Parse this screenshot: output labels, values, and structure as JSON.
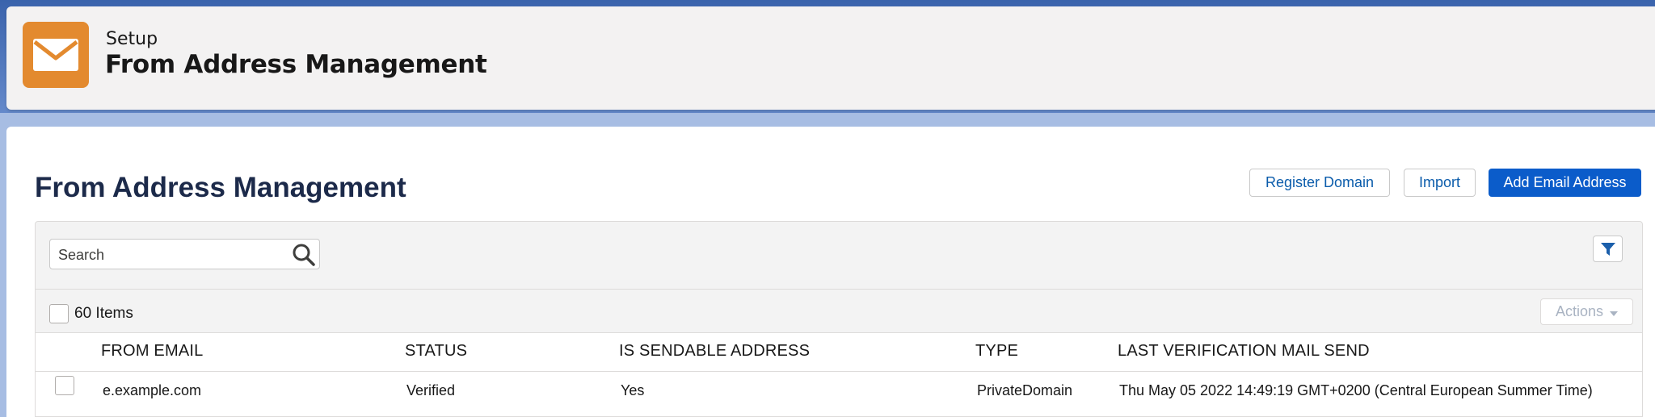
{
  "header": {
    "subtitle": "Setup",
    "title": "From Address Management",
    "icon": "mail-icon",
    "icon_color": "#e38a2f"
  },
  "main": {
    "title": "From Address Management",
    "buttons": {
      "register_domain": "Register Domain",
      "import": "Import",
      "add_email": "Add Email Address"
    },
    "accent_color": "#0b5cca"
  },
  "toolbar": {
    "search_placeholder": "Search",
    "items_count": "60 Items",
    "actions_label": "Actions"
  },
  "table": {
    "columns": [
      "FROM EMAIL",
      "STATUS",
      "IS SENDABLE ADDRESS",
      "TYPE",
      "LAST VERIFICATION MAIL SEND"
    ],
    "rows": [
      {
        "from_email": "e.example.com",
        "status": "Verified",
        "sendable": "Yes",
        "type": "PrivateDomain",
        "last_verification": "Thu May 05 2022 14:49:19 GMT+0200 (Central European Summer Time)"
      }
    ]
  }
}
